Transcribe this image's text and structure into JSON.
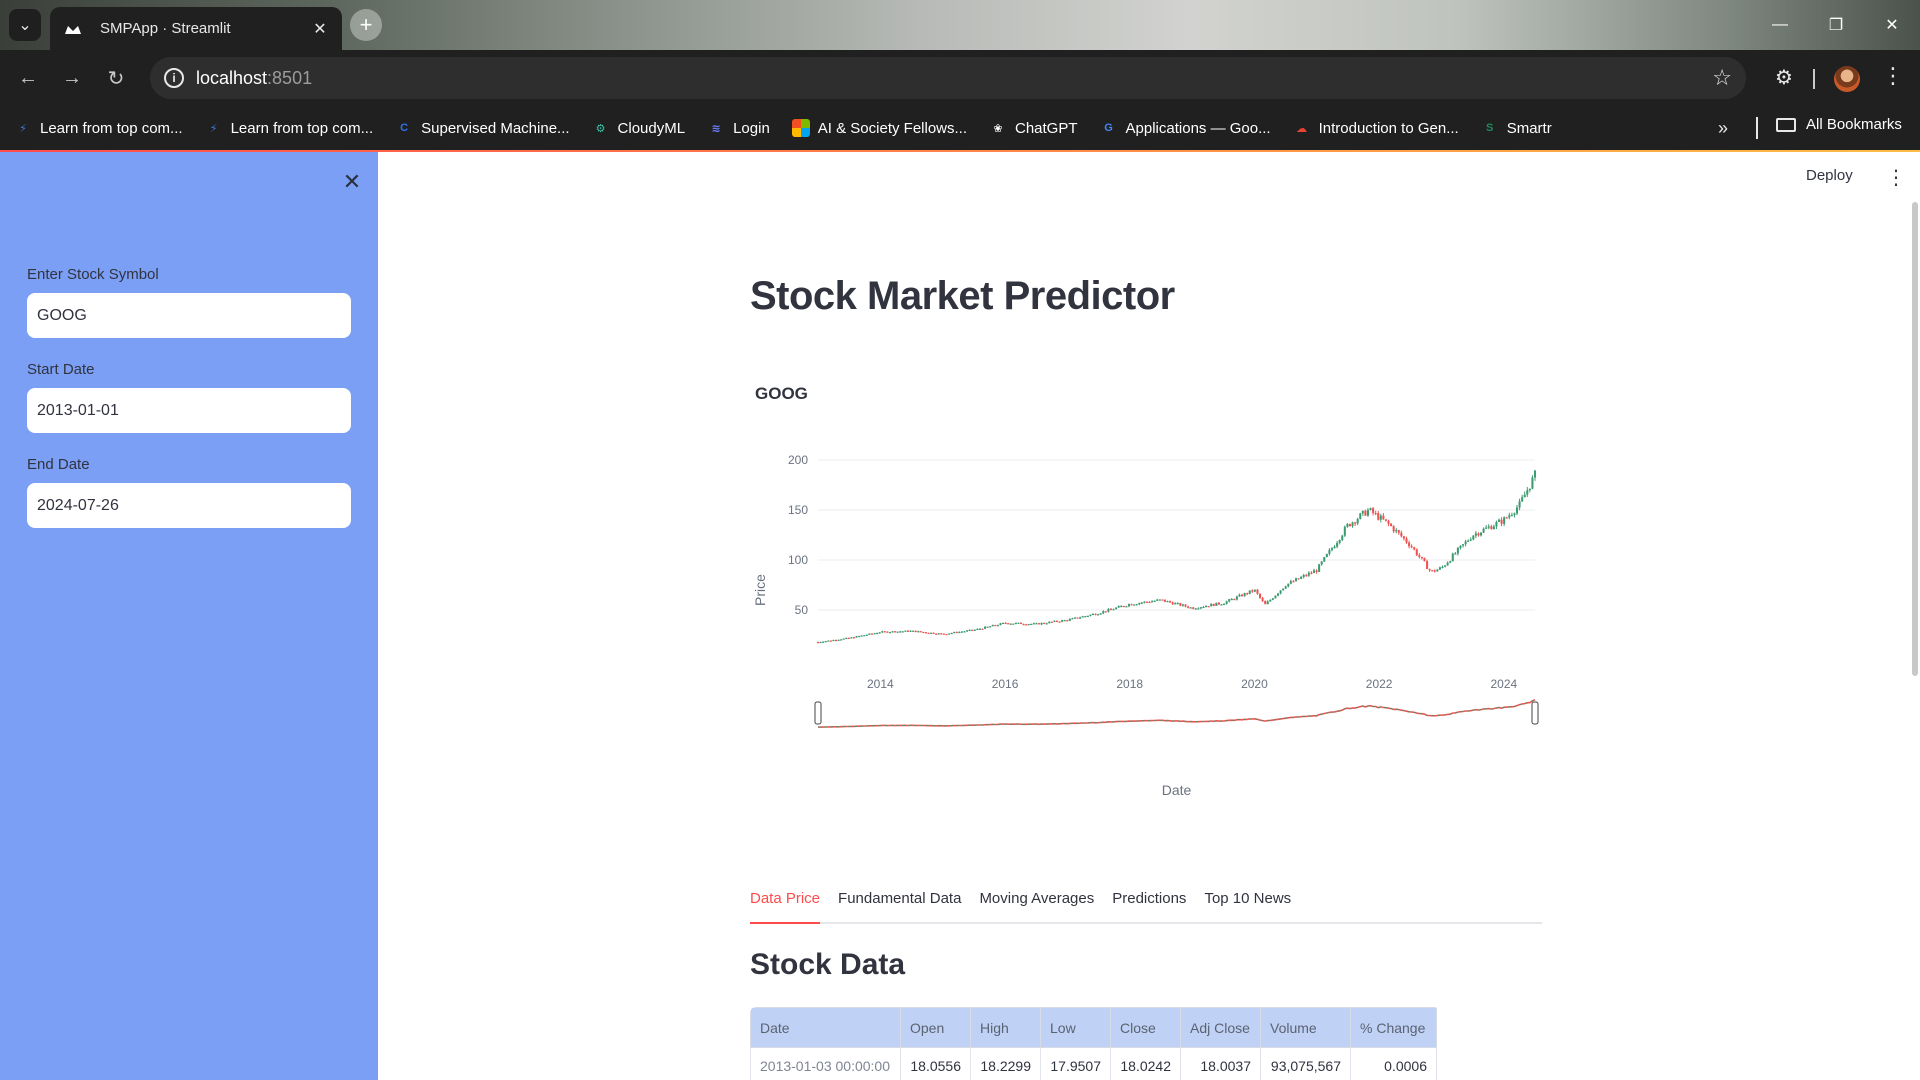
{
  "browser": {
    "tab_title": "SMPApp · Streamlit",
    "url_host": "localhost",
    "url_port": ":8501",
    "bookmarks": [
      {
        "label": "Learn from top com...",
        "icon": "lightning-icon",
        "color": "#3d7bd9"
      },
      {
        "label": "Learn from top com...",
        "icon": "lightning-icon",
        "color": "#3d7bd9"
      },
      {
        "label": "Supervised Machine...",
        "icon": "coursera-icon",
        "color": "#2a73e8"
      },
      {
        "label": "CloudyML",
        "icon": "cloudyml-icon",
        "color": "#3fbfa6"
      },
      {
        "label": "Login",
        "icon": "linear-icon",
        "color": "#6b7dff"
      },
      {
        "label": "AI & Society Fellows...",
        "icon": "microsoft-icon",
        "color": "#f25022"
      },
      {
        "label": "ChatGPT",
        "icon": "openai-icon",
        "color": "#ffffff"
      },
      {
        "label": "Applications — Goo...",
        "icon": "google-icon",
        "color": "#4285f4"
      },
      {
        "label": "Introduction to Gen...",
        "icon": "google-cloud-icon",
        "color": "#ea4335"
      },
      {
        "label": "Smartr",
        "icon": "smartr-icon",
        "color": "#1f8a5c"
      }
    ],
    "all_bookmarks_label": "All Bookmarks"
  },
  "sidebar": {
    "symbol_label": "Enter Stock Symbol",
    "symbol_value": "GOOG",
    "start_label": "Start Date",
    "start_value": "2013-01-01",
    "end_label": "End Date",
    "end_value": "2024-07-26"
  },
  "header": {
    "deploy_label": "Deploy"
  },
  "main": {
    "title": "Stock Market Predictor",
    "tabs": [
      {
        "label": "Data Price",
        "active": true
      },
      {
        "label": "Fundamental Data",
        "active": false
      },
      {
        "label": "Moving Averages",
        "active": false
      },
      {
        "label": "Predictions",
        "active": false
      },
      {
        "label": "Top 10 News",
        "active": false
      }
    ],
    "section_title": "Stock Data",
    "table": {
      "columns": [
        "Date",
        "Open",
        "High",
        "Low",
        "Close",
        "Adj Close",
        "Volume",
        "% Change"
      ],
      "rows": [
        [
          "2013-01-03 00:00:00",
          "18.0556",
          "18.2299",
          "17.9507",
          "18.0242",
          "18.0037",
          "93,075,567",
          "0.0006"
        ]
      ]
    }
  },
  "chart_data": {
    "type": "candlestick",
    "title": "GOOG",
    "xlabel": "Date",
    "ylabel": "Price",
    "x_ticks": [
      "2014",
      "2016",
      "2018",
      "2020",
      "2022",
      "2024"
    ],
    "y_ticks": [
      50,
      100,
      150,
      200
    ],
    "ylim": [
      0,
      200
    ],
    "xlim": [
      "2013-01-01",
      "2024-07-26"
    ],
    "grid": true,
    "range_slider": true,
    "colors": {
      "increasing": "#3d9970",
      "decreasing": "#ef5350"
    },
    "series": [
      {
        "x": [
          "2013-01",
          "2013-07",
          "2014-01",
          "2014-07",
          "2015-01",
          "2015-07",
          "2016-01",
          "2016-07",
          "2017-01",
          "2017-07",
          "2018-01",
          "2018-07",
          "2019-01",
          "2019-07",
          "2020-01",
          "2020-03",
          "2020-07",
          "2021-01",
          "2021-07",
          "2021-11",
          "2022-03",
          "2022-07",
          "2022-11",
          "2023-01",
          "2023-07",
          "2024-01",
          "2024-04",
          "2024-07"
        ],
        "close": [
          18,
          22,
          28,
          29,
          26,
          30,
          37,
          36,
          40,
          47,
          56,
          60,
          52,
          57,
          70,
          55,
          75,
          90,
          135,
          150,
          135,
          115,
          88,
          92,
          125,
          140,
          155,
          185
        ]
      }
    ]
  }
}
